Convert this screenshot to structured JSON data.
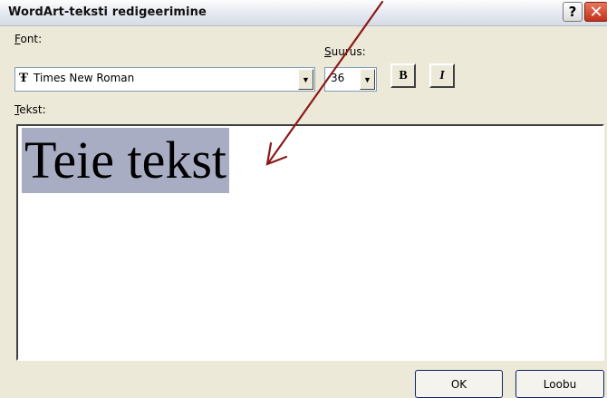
{
  "window": {
    "title": "WordArt-teksti redigeerimine",
    "help_label": "?",
    "close_label": "✕"
  },
  "font": {
    "label_u": "F",
    "label_rest": "ont:",
    "value": "Times New Roman",
    "icon": "truetype-font-icon",
    "icon_glyph": "Ŧ"
  },
  "size": {
    "label_u": "S",
    "label_rest": "uurus:",
    "value": "36"
  },
  "format": {
    "bold": "B",
    "italic": "I"
  },
  "text": {
    "label_u": "T",
    "label_rest": "ekst:",
    "content": "Teie tekst"
  },
  "buttons": {
    "ok": "OK",
    "cancel": "Loobu"
  },
  "annotation": {
    "color": "#8b1a1a"
  },
  "colors": {
    "dialog_bg": "#ece9d8",
    "selection": "#a8adc4",
    "close_red": "#c4321b"
  }
}
